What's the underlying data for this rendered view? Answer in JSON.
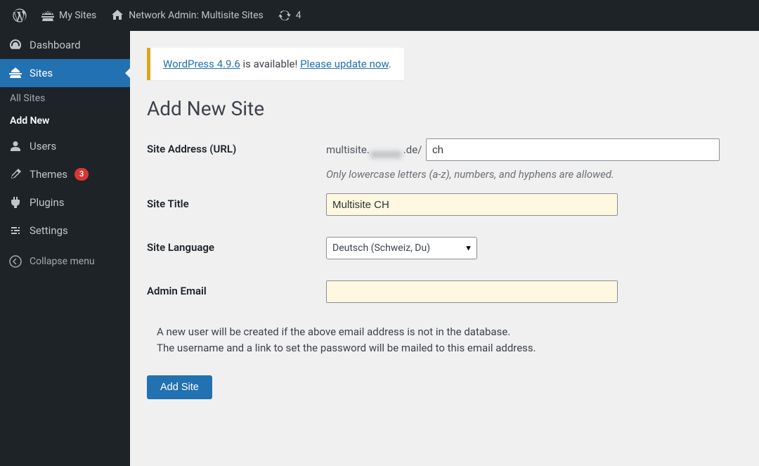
{
  "adminbar": {
    "mysites_label": "My Sites",
    "network_label": "Network Admin: Multisite Sites",
    "updates_count": "4"
  },
  "sidebar": {
    "dashboard_label": "Dashboard",
    "sites_label": "Sites",
    "sites_sub": {
      "all_sites": "All Sites",
      "add_new": "Add New"
    },
    "users_label": "Users",
    "themes_label": "Themes",
    "themes_badge": "3",
    "plugins_label": "Plugins",
    "settings_label": "Settings",
    "collapse_label": "Collapse menu"
  },
  "notice": {
    "link1": "WordPress 4.9.6",
    "mid": " is available! ",
    "link2": "Please update now",
    "tail": "."
  },
  "page": {
    "title": "Add New Site"
  },
  "form": {
    "site_address_label": "Site Address (URL)",
    "site_address_prefix_a": "multisite.",
    "site_address_prefix_b": ".de/",
    "site_address_value": "ch",
    "site_address_help": "Only lowercase letters (a-z), numbers, and hyphens are allowed.",
    "site_title_label": "Site Title",
    "site_title_value": "Multisite CH",
    "site_language_label": "Site Language",
    "site_language_value": "Deutsch (Schweiz, Du)",
    "admin_email_label": "Admin Email",
    "admin_email_value": "",
    "info_line1": "A new user will be created if the above email address is not in the database.",
    "info_line2": "The username and a link to set the password will be mailed to this email address.",
    "submit_label": "Add Site"
  }
}
